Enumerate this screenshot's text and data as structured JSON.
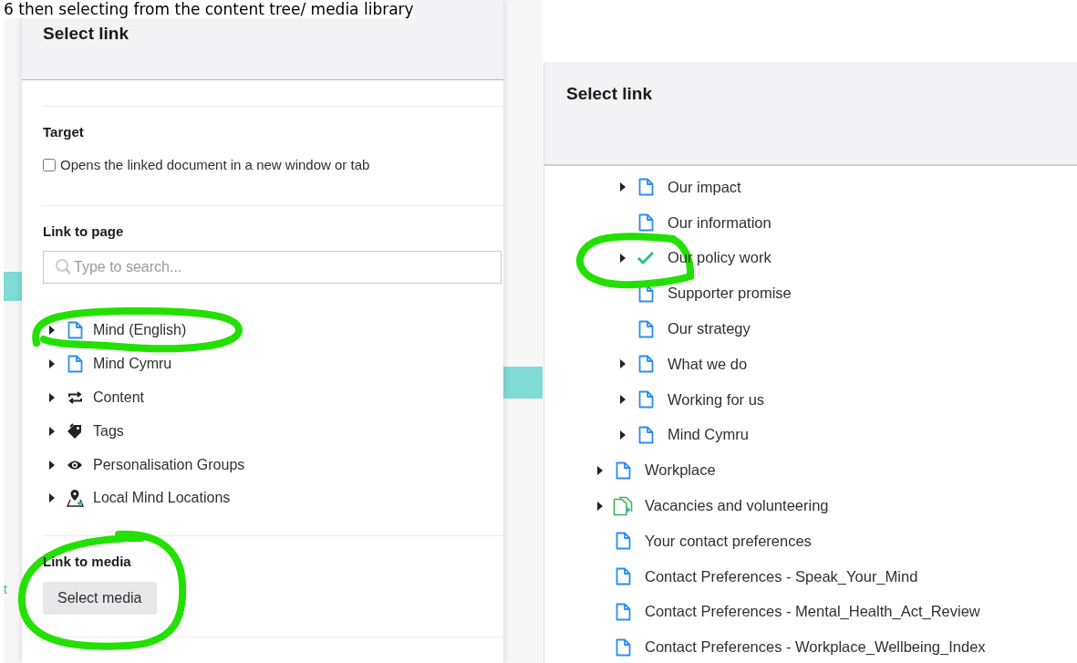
{
  "caption": "6 then selecting from the content tree/ media library",
  "background_app": {
    "text": "t"
  },
  "left_dialog": {
    "title": "Select link",
    "target": {
      "heading": "Target",
      "checkbox": {
        "label": "Opens the linked document in a new window or tab",
        "checked": false
      }
    },
    "link_to_page": {
      "heading": "Link to page",
      "search": {
        "placeholder": "Type to search..."
      },
      "tree": [
        {
          "label": "Mind (English)",
          "kind": "document",
          "expandable": true
        },
        {
          "label": "Mind Cymru",
          "kind": "document",
          "expandable": true
        },
        {
          "label": "Content",
          "kind": "content",
          "expandable": true
        },
        {
          "label": "Tags",
          "kind": "tags",
          "expandable": true
        },
        {
          "label": "Personalisation Groups",
          "kind": "groups",
          "expandable": true
        },
        {
          "label": "Local Mind Locations",
          "kind": "locations",
          "expandable": true
        }
      ]
    },
    "link_to_media": {
      "heading": "Link to media",
      "button": "Select media"
    }
  },
  "right_dialog": {
    "title": "Select link",
    "tree": [
      {
        "children": [
          {
            "label": "Our impact",
            "kind": "document",
            "expandable": true,
            "selected": false
          },
          {
            "label": "Our information",
            "kind": "document",
            "expandable": false,
            "selected": false
          },
          {
            "label": "Our policy work",
            "kind": "document",
            "expandable": true,
            "selected": true
          },
          {
            "label": "Supporter promise",
            "kind": "document",
            "expandable": false,
            "selected": false
          },
          {
            "label": "Our strategy",
            "kind": "document",
            "expandable": false,
            "selected": false
          },
          {
            "label": "What we do",
            "kind": "document",
            "expandable": true,
            "selected": false
          },
          {
            "label": "Working for us",
            "kind": "document",
            "expandable": true,
            "selected": false
          },
          {
            "label": "Mind Cymru",
            "kind": "document",
            "expandable": true,
            "selected": false
          }
        ]
      },
      {
        "label": "Workplace",
        "kind": "document",
        "expandable": true,
        "selected": false
      },
      {
        "label": "Vacancies and volunteering",
        "kind": "job-document",
        "expandable": true,
        "selected": false
      },
      {
        "label": "Your contact preferences",
        "kind": "document",
        "expandable": false,
        "selected": false
      },
      {
        "label": "Contact Preferences - Speak_Your_Mind",
        "kind": "document",
        "expandable": false,
        "selected": false
      },
      {
        "label": "Contact Preferences - Mental_Health_Act_Review",
        "kind": "document",
        "expandable": false,
        "selected": false
      },
      {
        "label": "Contact Preferences - Workplace_Wellbeing_Index",
        "kind": "document",
        "expandable": false,
        "selected": false
      }
    ]
  }
}
